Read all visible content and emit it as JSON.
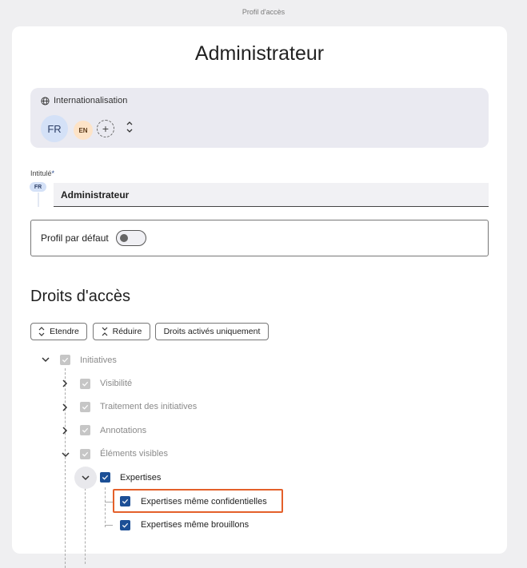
{
  "window": {
    "title": "Profil d'accès"
  },
  "page": {
    "title": "Administrateur"
  },
  "internationalisation": {
    "label": "Internationalisation",
    "languages": [
      "FR",
      "EN"
    ],
    "add_label": "+",
    "sort_label": "⌃⌄"
  },
  "intitule": {
    "label": "Intitulé",
    "required_mark": "*",
    "lang_chip": "FR",
    "value": "Administrateur"
  },
  "default_profile": {
    "label": "Profil par défaut",
    "enabled": false
  },
  "rights": {
    "title": "Droits d'accès",
    "buttons": {
      "expand": "Etendre",
      "collapse": "Réduire",
      "active_only": "Droits activés uniquement"
    },
    "tree": [
      {
        "label": "Initiatives",
        "state": "disabled-checked"
      },
      {
        "label": "Visibilité",
        "state": "disabled-checked"
      },
      {
        "label": "Traitement des initiatives",
        "state": "disabled-checked"
      },
      {
        "label": "Annotations",
        "state": "disabled-checked"
      },
      {
        "label": "Éléments visibles",
        "state": "disabled-checked"
      },
      {
        "label": "Expertises",
        "state": "checked"
      },
      {
        "label": "Expertises même confidentielles",
        "state": "checked",
        "highlighted": true
      },
      {
        "label": "Expertises même brouillons",
        "state": "checked"
      }
    ]
  },
  "colors": {
    "accent": "#1c4f96",
    "highlight": "#e4602a",
    "lang_fr_bg": "#d4e1f7",
    "lang_en_bg": "#fde3c7",
    "disabled_checkbox": "#c6c6c6"
  }
}
